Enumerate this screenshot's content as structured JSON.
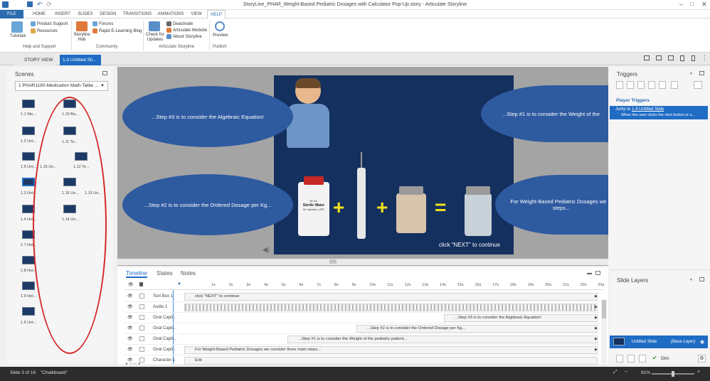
{
  "window": {
    "title": "StoryLine_PHAR_Weight-Based Pediatric Dosages with Calculator Pop-Up.story - Articulate Storyline",
    "app_icon": "storyline-icon"
  },
  "ribbon_tabs": [
    "FILE",
    "HOME",
    "INSERT",
    "SLIDES",
    "DESIGN",
    "TRANSITIONS",
    "ANIMATIONS",
    "VIEW",
    "HELP"
  ],
  "ribbon": {
    "help_support": {
      "tutorials": "Tutorials",
      "product_support": "Product Support",
      "resources": "Resources",
      "group": "Help and Support"
    },
    "community": {
      "hub": "Storyline Hub",
      "forums": "Forums",
      "blog": "Rapid E-Learning Blog",
      "group": "Community"
    },
    "articulate": {
      "updates": "Check for Updates",
      "deactivate": "Deactivate",
      "website": "Articulate Website",
      "about": "About Storyline",
      "group": "Articulate Storyline"
    },
    "publish": {
      "preview": "Preview",
      "group": "Publish"
    }
  },
  "doc_tabs": {
    "story_view": "STORY VIEW",
    "active": "1.3 Untitled Sli..."
  },
  "scenes": {
    "title": "Scenes",
    "selected": "1 PHAR1180-Medication Math-Table ...",
    "thumbs": [
      "1.1 We...",
      "1.10 Ba...",
      "1.2 Unt...",
      "1.11 Te...",
      "1.5 Unt...",
      "1.15 Un...",
      "1.12 Te...",
      "1.3 Unt...",
      "1.16 Un...",
      "1.13 Un...",
      "1.4 Unt...",
      "1.14 Un...",
      "1.7 Hot...",
      "1.8 Hot...",
      "1.9 Hot...",
      "1.6 Unt..."
    ]
  },
  "slide": {
    "ovals": [
      "...Step #3 is to consider the Algebraic Equation!",
      "...Step #1 is to consider the Weight of the",
      "...Step #2 is to consider the Ordered Dosage per Kg...",
      "For Weight-Based Pediatric Dosages we ... steps..."
    ],
    "vial_label": "Sterile Water",
    "vial_sub": "for Injection, USP",
    "vial_top": "50 mL",
    "plus1": "+",
    "plus2": "+",
    "equals": "=",
    "next_text": "click \"NEXT\" to continue"
  },
  "timeline": {
    "tabs": [
      "Timeline",
      "States",
      "Notes"
    ],
    "ticks": [
      "1s",
      "2s",
      "3s",
      "4s",
      "5s",
      "6s",
      "7s",
      "8s",
      "9s",
      "10s",
      "11s",
      "12s",
      "13s",
      "14s",
      "15s",
      "16s",
      "17s",
      "18s",
      "19s",
      "20s",
      "21s",
      "22s",
      "23s"
    ],
    "rows": [
      {
        "name": "Text Box 1",
        "bar": "click \"NEXT\" to continue"
      },
      {
        "name": "Audio 1",
        "bar": ""
      },
      {
        "name": "Oval Capti...",
        "bar": "...Step #3 is to consider the Algebraic Equation!"
      },
      {
        "name": "Oval Capti...",
        "bar": "...Step #2 is to consider the Ordered Dosage per Kg..."
      },
      {
        "name": "Oval Capti...",
        "bar": "...Step #1 is to consider the Weight of the pediatric patient..."
      },
      {
        "name": "Oval Capti...",
        "bar": "For Weight-Based Pediatric Dosages we consider three main steps..."
      },
      {
        "name": "Character 1",
        "bar": "Erik"
      }
    ]
  },
  "triggers": {
    "title": "Triggers",
    "section": "Player Triggers",
    "jump": "Jump to",
    "jump_link": "1.4 Untitled Slide",
    "when": "When the user clicks the next button or s..."
  },
  "layers": {
    "title": "Slide Layers",
    "base": "Untitled Slide",
    "base_tag": "(Base Layer)",
    "dim": "Dim"
  },
  "status": {
    "slide": "Slide 3 of 16",
    "theme": "\"Chalkboard\"",
    "zoom": "91%"
  },
  "colors": {
    "accent": "#2b6cb0",
    "oval": "#2e5aa0",
    "slide_bg": "#14305e",
    "selection": "#1f6cc4"
  }
}
